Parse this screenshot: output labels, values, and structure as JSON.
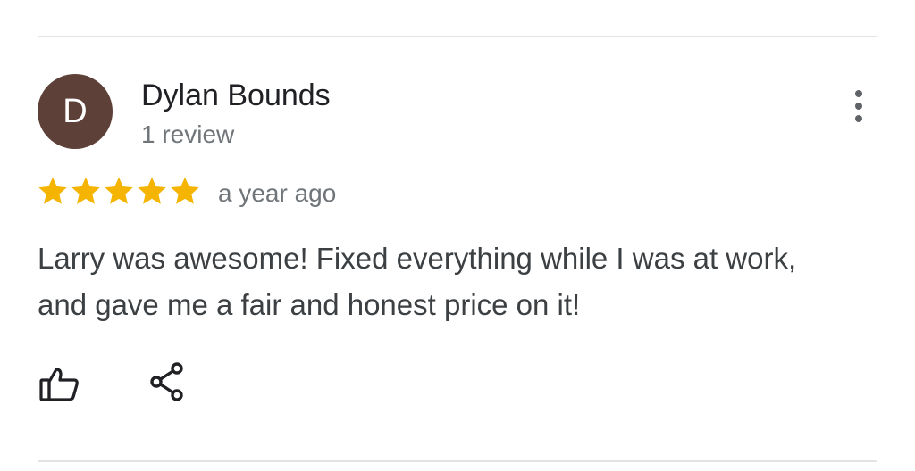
{
  "review": {
    "avatar_initial": "D",
    "avatar_color": "#5d4037",
    "reviewer_name": "Dylan Bounds",
    "review_count": "1 review",
    "rating": 5,
    "rating_max": 5,
    "star_color": "#f4b400",
    "time": "a year ago",
    "text": "Larry was awesome! Fixed everything while I was at work, and gave me a fair and honest price on it!"
  },
  "actions": {
    "more_icon": "more-vert-icon",
    "like_icon": "thumbs-up-icon",
    "share_icon": "share-icon"
  }
}
